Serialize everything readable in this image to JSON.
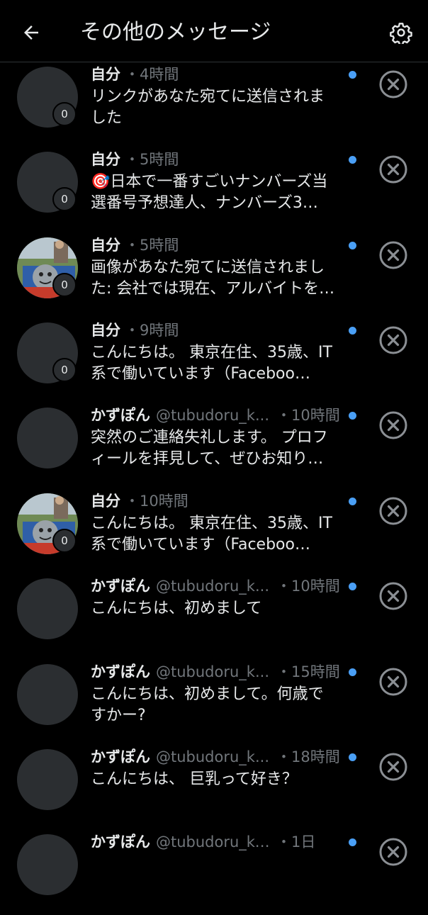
{
  "header": {
    "title": "その他のメッセージ",
    "back_icon": "arrow-left-icon",
    "settings_icon": "gear-icon"
  },
  "colors": {
    "background": "#000000",
    "text": "#e7e9ea",
    "muted": "#71767b",
    "unread_dot": "#4a9ff5",
    "avatar_placeholder": "#2b2e31"
  },
  "messages": [
    {
      "sender": "自分",
      "handle": "",
      "time": "・4時間",
      "text": "リンクがあなた宛てに送信されました",
      "badge": "0",
      "avatar": "placeholder"
    },
    {
      "sender": "自分",
      "handle": "",
      "time": "・5時間",
      "text": "🎯日本で一番すごいナンバーズ当選番号予想達人、ナンバーズ3…",
      "badge": "0",
      "avatar": "placeholder"
    },
    {
      "sender": "自分",
      "handle": "",
      "time": "・5時間",
      "text": "画像があなた宛てに送信されました: 会社では現在、アルバイトを…",
      "badge": "0",
      "avatar": "photo"
    },
    {
      "sender": "自分",
      "handle": "",
      "time": "・9時間",
      "text": "こんにちは。 東京在住、35歳、IT系で働いています（Faceboo…",
      "badge": "0",
      "avatar": "placeholder"
    },
    {
      "sender": "かずぽん",
      "handle": "@tubudoru_k...",
      "time": "・10時間",
      "text": "突然のご連絡失礼します。 プロフィールを拝見して、ぜひお知り…",
      "badge": "",
      "avatar": "placeholder"
    },
    {
      "sender": "自分",
      "handle": "",
      "time": "・10時間",
      "text": "こんにちは。 東京在住、35歳、IT系で働いています（Faceboo…",
      "badge": "0",
      "avatar": "photo"
    },
    {
      "sender": "かずぽん",
      "handle": "@tubudoru_k...",
      "time": "・10時間",
      "text": "こんにちは、初めまして",
      "badge": "",
      "avatar": "placeholder"
    },
    {
      "sender": "かずぽん",
      "handle": "@tubudoru_k...",
      "time": "・15時間",
      "text": "こんにちは、初めまして。何歳ですかー?",
      "badge": "",
      "avatar": "placeholder"
    },
    {
      "sender": "かずぽん",
      "handle": "@tubudoru_k...",
      "time": "・18時間",
      "text": "こんにちは、 巨乳って好き？",
      "badge": "",
      "avatar": "placeholder"
    },
    {
      "sender": "かずぽん",
      "handle": "@tubudoru_kazu",
      "time": "・1日",
      "text": "",
      "badge": "",
      "avatar": "placeholder"
    }
  ]
}
